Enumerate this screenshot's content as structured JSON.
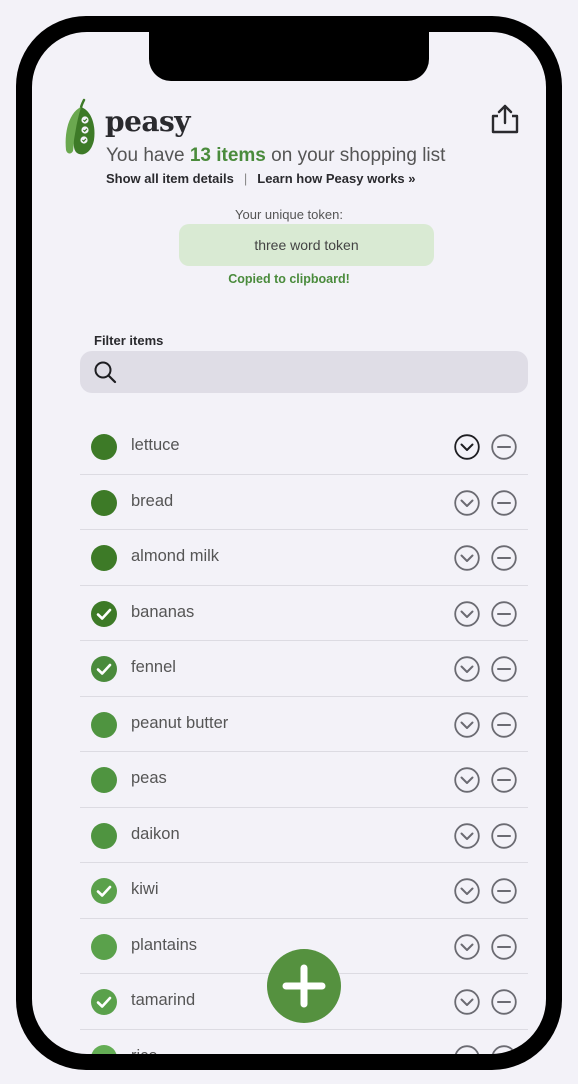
{
  "app": {
    "name": "peasy",
    "summary_prefix": "You have ",
    "summary_count": "13 items",
    "summary_suffix": " on your shopping list"
  },
  "links": {
    "show_details": "Show all item details",
    "separator": "|",
    "learn": "Learn how Peasy works »"
  },
  "token": {
    "label": "Your unique token:",
    "value": "three word token",
    "copied_message": "Copied to clipboard!"
  },
  "filter": {
    "label": "Filter items",
    "value": "",
    "placeholder": ""
  },
  "colors": {
    "accent": "#4a8b3c",
    "token_bg": "#d9ead3",
    "fab": "#55913f"
  },
  "icons": {
    "share": "share-icon",
    "search": "search-icon",
    "expand": "chevron-down-circle-icon",
    "remove": "minus-circle-icon",
    "add": "plus-icon",
    "logo": "pea-pod-icon"
  },
  "items": [
    {
      "name": "lettuce",
      "checked": false,
      "color": "#3d7a27"
    },
    {
      "name": "bread",
      "checked": false,
      "color": "#3d7a27"
    },
    {
      "name": "almond milk",
      "checked": false,
      "color": "#3d7a27"
    },
    {
      "name": "bananas",
      "checked": true,
      "color": "#3d7a27"
    },
    {
      "name": "fennel",
      "checked": true,
      "color": "#4a8b3c"
    },
    {
      "name": "peanut butter",
      "checked": false,
      "color": "#4f9440"
    },
    {
      "name": "peas",
      "checked": false,
      "color": "#4f9440"
    },
    {
      "name": "daikon",
      "checked": false,
      "color": "#4f9440"
    },
    {
      "name": "kiwi",
      "checked": true,
      "color": "#5aa14b"
    },
    {
      "name": "plantains",
      "checked": false,
      "color": "#5aa14b"
    },
    {
      "name": "tamarind",
      "checked": true,
      "color": "#5aa14b"
    },
    {
      "name": "rice",
      "checked": false,
      "color": "#64ad55"
    }
  ]
}
